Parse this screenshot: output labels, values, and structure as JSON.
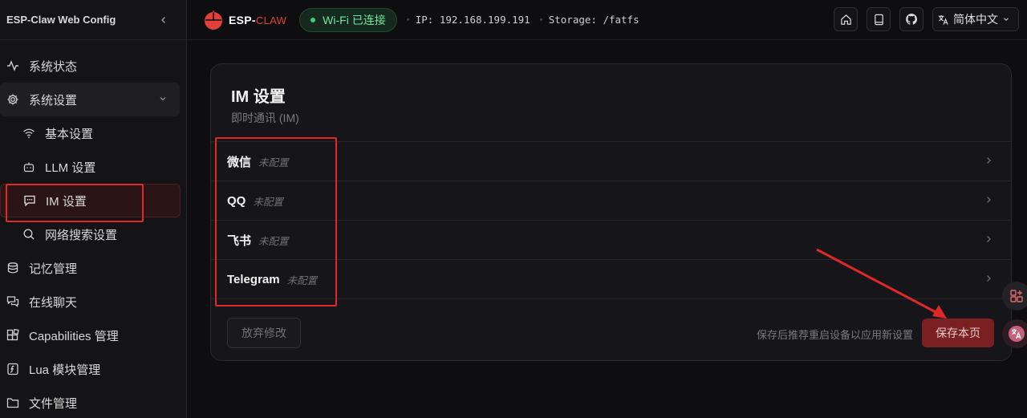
{
  "sidebar": {
    "title": "ESP-Claw Web Config",
    "items": [
      {
        "label": "系统状态",
        "icon": "activity-icon"
      },
      {
        "label": "系统设置",
        "icon": "gear-icon"
      },
      {
        "label": "基本设置",
        "icon": "wifi-icon"
      },
      {
        "label": "LLM 设置",
        "icon": "bot-icon"
      },
      {
        "label": "IM 设置",
        "icon": "message-icon"
      },
      {
        "label": "网络搜索设置",
        "icon": "search-icon"
      },
      {
        "label": "记忆管理",
        "icon": "database-icon"
      },
      {
        "label": "在线聊天",
        "icon": "chat-icon"
      },
      {
        "label": "Capabilities 管理",
        "icon": "blocks-icon"
      },
      {
        "label": "Lua 模块管理",
        "icon": "script-icon"
      },
      {
        "label": "文件管理",
        "icon": "folder-icon"
      }
    ]
  },
  "header": {
    "logo_main": "ESP-",
    "logo_accent": "CLAW",
    "wifi_status": "Wi-Fi 已连接",
    "ip": "IP: 192.168.199.191",
    "storage": "Storage: /fatfs",
    "language": "简体中文"
  },
  "card": {
    "title": "IM 设置",
    "subtitle": "即时通讯 (IM)",
    "rows": [
      {
        "name": "微信",
        "status": "未配置"
      },
      {
        "name": "QQ",
        "status": "未配置"
      },
      {
        "name": "飞书",
        "status": "未配置"
      },
      {
        "name": "Telegram",
        "status": "未配置"
      }
    ],
    "discard_label": "放弃修改",
    "hint": "保存后推荐重启设备以应用新设置",
    "save_label": "保存本页"
  },
  "colors": {
    "accent": "#e0403a",
    "save_bg": "#7a1f22",
    "wifi_green": "#3ccf7a",
    "annotation_red": "#e02828"
  }
}
